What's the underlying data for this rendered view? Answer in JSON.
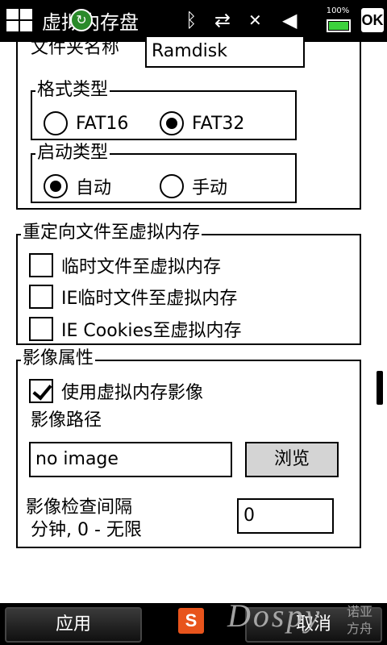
{
  "statusbar": {
    "title": "虚拟内存盘",
    "battery_percent": "100%",
    "ok_label": "OK",
    "icons": [
      "windows-start-icon",
      "sync-icon",
      "bluetooth-icon",
      "data-transfer-icon",
      "no-sim-icon",
      "volume-muted-icon",
      "battery-icon"
    ]
  },
  "top_group": {
    "folder_name_label": "文件夹名称",
    "folder_name_value": "Ramdisk",
    "format": {
      "legend": "格式类型",
      "options": [
        {
          "label": "FAT16",
          "selected": false
        },
        {
          "label": "FAT32",
          "selected": true
        }
      ]
    },
    "startup": {
      "legend": "启动类型",
      "options": [
        {
          "label": "自动",
          "selected": true
        },
        {
          "label": "手动",
          "selected": false
        }
      ]
    }
  },
  "redirect": {
    "legend": "重定向文件至虚拟内存",
    "options": [
      {
        "label": "临时文件至虚拟内存",
        "checked": false
      },
      {
        "label": "IE临时文件至虚拟内存",
        "checked": false
      },
      {
        "label": "IE Cookies至虚拟内存",
        "checked": false
      }
    ]
  },
  "image": {
    "legend": "影像属性",
    "use_image_label": "使用虚拟内存影像",
    "use_image_checked": true,
    "path_label": "影像路径",
    "path_value": "no image",
    "browse_label": "浏览",
    "interval_label_line1": "影像检查间隔",
    "interval_label_line2": "分钟, 0 - 无限",
    "interval_value": "0"
  },
  "bottombar": {
    "left_softkey": "应用",
    "right_softkey": "取消",
    "ime_label": "S",
    "watermark": "Dospy",
    "watermark_cn_line1": "诺亚",
    "watermark_cn_line2": "方舟"
  }
}
